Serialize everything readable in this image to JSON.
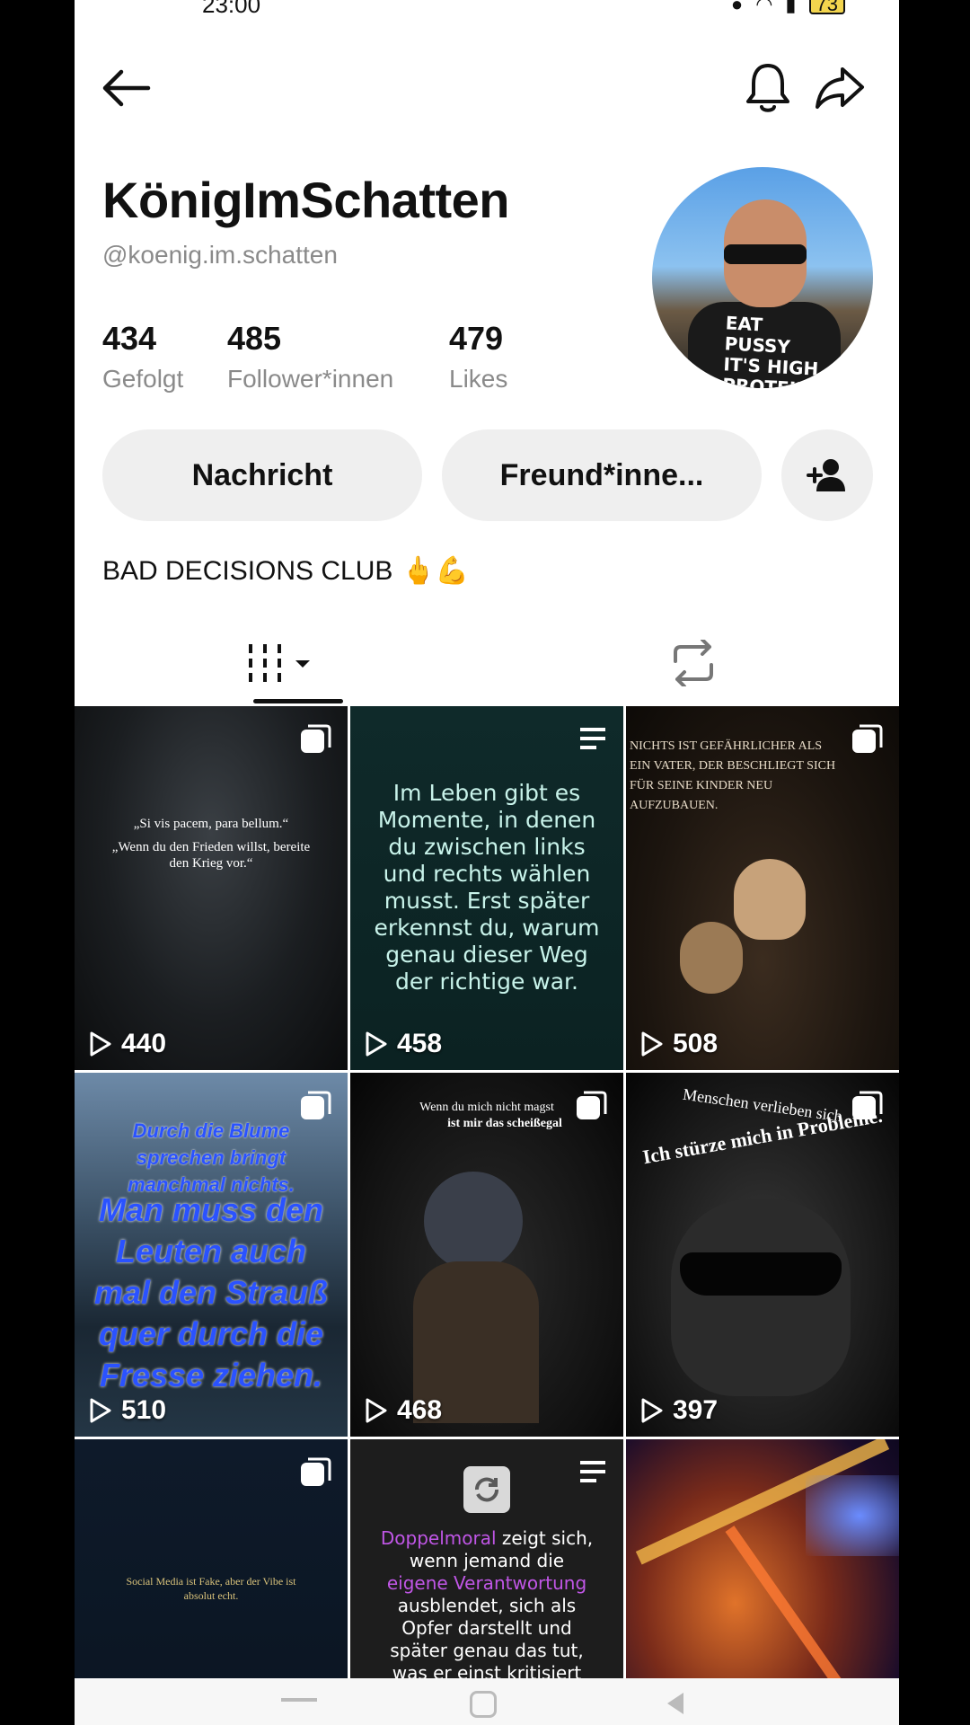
{
  "status_bar": {
    "time": "23:00",
    "battery": "73"
  },
  "profile": {
    "display_name": "KönigImSchatten",
    "handle": "@koenig.im.schatten",
    "stats": [
      {
        "value": "434",
        "label": "Gefolgt"
      },
      {
        "value": "485",
        "label": "Follower*innen"
      },
      {
        "value": "479",
        "label": "Likes"
      }
    ],
    "avatar_shirt_text": "EAT\nPUSSY\nIT'S HIGH\nPROTEIN",
    "bio": "BAD DECISIONS CLUB",
    "bio_emoji": "🖕💪"
  },
  "actions": {
    "message_label": "Nachricht",
    "friends_label": "Freund*inne..."
  },
  "tabs": [
    {
      "name": "videos",
      "icon": "grid-dropdown-icon",
      "active": true
    },
    {
      "name": "reposts",
      "icon": "repost-icon",
      "active": false
    }
  ],
  "videos": [
    {
      "views": "440",
      "badge": "multi-icon",
      "caption_line1": "„Si vis pacem, para bellum.“",
      "caption_line2": "„Wenn du den Frieden willst, bereite den Krieg vor.“"
    },
    {
      "views": "458",
      "badge": "text-icon",
      "caption": "Im Leben gibt es Momente, in denen du zwischen links und rechts wählen musst. Erst später erkennst du, warum genau dieser Weg der richtige war."
    },
    {
      "views": "508",
      "badge": "multi-icon",
      "caption": "NICHTS IST GEFÄHRLICHER ALS EIN VATER, DER BESCHLIEGT SICH FÜR SEINE KINDER NEU AUFZUBAUEN."
    },
    {
      "views": "510",
      "badge": "multi-icon",
      "caption_small": "Durch die Blume sprechen bringt manchmal nichts.",
      "caption_big": "Man muss den Leuten auch mal den Strauß quer durch die Fresse ziehen."
    },
    {
      "views": "468",
      "badge": "multi-icon",
      "caption_line1": "Wenn du mich nicht magst",
      "caption_line2": "ist mir das scheißegal"
    },
    {
      "views": "397",
      "badge": "multi-icon",
      "caption_line1": "Menschen verlieben sich",
      "caption_line2": "Ich stürze mich in Probleme."
    },
    {
      "views": "",
      "badge": "multi-icon",
      "caption": "Social Media ist Fake, aber der Vibe ist absolut echt."
    },
    {
      "views": "",
      "badge": "text-icon",
      "caption_pre": "Doppelmoral",
      "caption_mid": " zeigt sich, wenn jemand die ",
      "caption_hl": "eigene Verantwortung",
      "caption_post": " ausblendet, sich als Opfer darstellt und später genau das tut, was er einst kritisiert"
    },
    {
      "views": "",
      "badge": "",
      "caption": ""
    }
  ],
  "colors": {
    "accent_purple": "#c056e6",
    "caption_teal": "#c8f3ea",
    "caption_blue": "#2a52ff"
  }
}
